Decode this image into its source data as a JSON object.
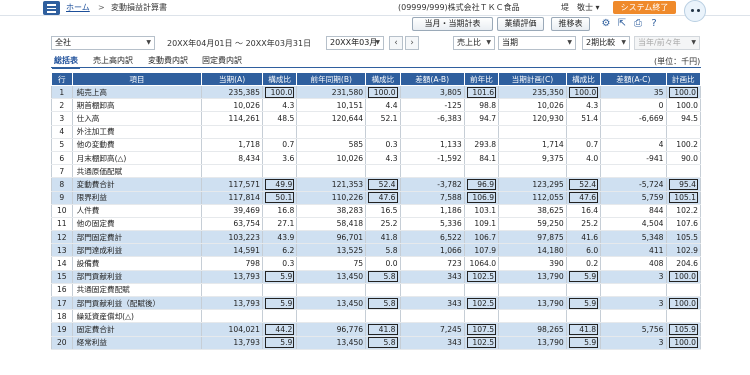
{
  "header": {
    "breadcrumb_home": "ホーム",
    "breadcrumb_sep": ">",
    "page_title": "変動損益計算書",
    "company": "(09999/999)株式会社ＴＫＣ食品",
    "user": "堤　敬士",
    "logout": "システム終了"
  },
  "toolbar": {
    "btn1": "当月・当期計表",
    "btn2": "業績評価",
    "btn3": "推移表"
  },
  "filters": {
    "scope": "全社",
    "period": "20XX年04月01日 ～ 20XX年03月31日",
    "month": "20XX年03月",
    "compare1": "売上比",
    "compare2": "当期",
    "compare3": "2期比較",
    "compare4": "当年/前々年"
  },
  "tabs": [
    "総括表",
    "売上高内訳",
    "変動費内訳",
    "固定費内訳"
  ],
  "unit": "(単位：千円)",
  "columns": [
    "行",
    "項目",
    "当期(A)",
    "構成比",
    "前年同期(B)",
    "構成比",
    "差額(A-B)",
    "前年比",
    "当期計画(C)",
    "構成比",
    "差額(A-C)",
    "計画比"
  ],
  "rows": [
    {
      "no": "1",
      "name": "純売上高",
      "a": "235,385",
      "ar": "100.0",
      "b": "231,580",
      "br": "100.0",
      "d": "3,805",
      "dr": "101.6",
      "c": "235,350",
      "cr": "100.0",
      "e": "35",
      "er": "100.0"
    },
    {
      "no": "2",
      "name": "期首棚卸高",
      "a": "10,026",
      "ar": "4.3",
      "b": "10,151",
      "br": "4.4",
      "d": "-125",
      "dr": "98.8",
      "c": "10,026",
      "cr": "4.3",
      "e": "0",
      "er": "100.0"
    },
    {
      "no": "3",
      "name": "仕入高",
      "a": "114,261",
      "ar": "48.5",
      "b": "120,644",
      "br": "52.1",
      "d": "-6,383",
      "dr": "94.7",
      "c": "120,930",
      "cr": "51.4",
      "e": "-6,669",
      "er": "94.5"
    },
    {
      "no": "4",
      "name": "外注加工費",
      "a": "",
      "ar": "",
      "b": "",
      "br": "",
      "d": "",
      "dr": "",
      "c": "",
      "cr": "",
      "e": "",
      "er": ""
    },
    {
      "no": "5",
      "name": "他の変動費",
      "a": "1,718",
      "ar": "0.7",
      "b": "585",
      "br": "0.3",
      "d": "1,133",
      "dr": "293.8",
      "c": "1,714",
      "cr": "0.7",
      "e": "4",
      "er": "100.2"
    },
    {
      "no": "6",
      "name": "月末棚卸高(△)",
      "a": "8,434",
      "ar": "3.6",
      "b": "10,026",
      "br": "4.3",
      "d": "-1,592",
      "dr": "84.1",
      "c": "9,375",
      "cr": "4.0",
      "e": "-941",
      "er": "90.0"
    },
    {
      "no": "7",
      "name": "共通原価配賦",
      "a": "",
      "ar": "",
      "b": "",
      "br": "",
      "d": "",
      "dr": "",
      "c": "",
      "cr": "",
      "e": "",
      "er": ""
    },
    {
      "no": "8",
      "name": "変動費合計",
      "a": "117,571",
      "ar": "49.9",
      "b": "121,353",
      "br": "52.4",
      "d": "-3,782",
      "dr": "96.9",
      "c": "123,295",
      "cr": "52.4",
      "e": "-5,724",
      "er": "95.4"
    },
    {
      "no": "9",
      "name": "限界利益",
      "a": "117,814",
      "ar": "50.1",
      "b": "110,226",
      "br": "47.6",
      "d": "7,588",
      "dr": "106.9",
      "c": "112,055",
      "cr": "47.6",
      "e": "5,759",
      "er": "105.1"
    },
    {
      "no": "10",
      "name": "人件費",
      "a": "39,469",
      "ar": "16.8",
      "b": "38,283",
      "br": "16.5",
      "d": "1,186",
      "dr": "103.1",
      "c": "38,625",
      "cr": "16.4",
      "e": "844",
      "er": "102.2"
    },
    {
      "no": "11",
      "name": "他の固定費",
      "a": "63,754",
      "ar": "27.1",
      "b": "58,418",
      "br": "25.2",
      "d": "5,336",
      "dr": "109.1",
      "c": "59,250",
      "cr": "25.2",
      "e": "4,504",
      "er": "107.6"
    },
    {
      "no": "12",
      "name": "部門固定費計",
      "a": "103,223",
      "ar": "43.9",
      "b": "96,701",
      "br": "41.8",
      "d": "6,522",
      "dr": "106.7",
      "c": "97,875",
      "cr": "41.6",
      "e": "5,348",
      "er": "105.5"
    },
    {
      "no": "13",
      "name": "部門達成利益",
      "a": "14,591",
      "ar": "6.2",
      "b": "13,525",
      "br": "5.8",
      "d": "1,066",
      "dr": "107.9",
      "c": "14,180",
      "cr": "6.0",
      "e": "411",
      "er": "102.9"
    },
    {
      "no": "14",
      "name": "設備費",
      "a": "798",
      "ar": "0.3",
      "b": "75",
      "br": "0.0",
      "d": "723",
      "dr": "1064.0",
      "c": "390",
      "cr": "0.2",
      "e": "408",
      "er": "204.6"
    },
    {
      "no": "15",
      "name": "部門貢献利益",
      "a": "13,793",
      "ar": "5.9",
      "b": "13,450",
      "br": "5.8",
      "d": "343",
      "dr": "102.5",
      "c": "13,790",
      "cr": "5.9",
      "e": "3",
      "er": "100.0"
    },
    {
      "no": "16",
      "name": "共通固定費配賦",
      "a": "",
      "ar": "",
      "b": "",
      "br": "",
      "d": "",
      "dr": "",
      "c": "",
      "cr": "",
      "e": "",
      "er": ""
    },
    {
      "no": "17",
      "name": "部門貢献利益（配賦後）",
      "a": "13,793",
      "ar": "5.9",
      "b": "13,450",
      "br": "5.8",
      "d": "343",
      "dr": "102.5",
      "c": "13,790",
      "cr": "5.9",
      "e": "3",
      "er": "100.0"
    },
    {
      "no": "18",
      "name": "繰延資産償却(△)",
      "a": "",
      "ar": "",
      "b": "",
      "br": "",
      "d": "",
      "dr": "",
      "c": "",
      "cr": "",
      "e": "",
      "er": ""
    },
    {
      "no": "19",
      "name": "固定費合計",
      "a": "104,021",
      "ar": "44.2",
      "b": "96,776",
      "br": "41.8",
      "d": "7,245",
      "dr": "107.5",
      "c": "98,265",
      "cr": "41.8",
      "e": "5,756",
      "er": "105.9"
    },
    {
      "no": "20",
      "name": "経常利益",
      "a": "13,793",
      "ar": "5.9",
      "b": "13,450",
      "br": "5.8",
      "d": "343",
      "dr": "102.5",
      "c": "13,790",
      "cr": "5.9",
      "e": "3",
      "er": "100.0"
    }
  ]
}
